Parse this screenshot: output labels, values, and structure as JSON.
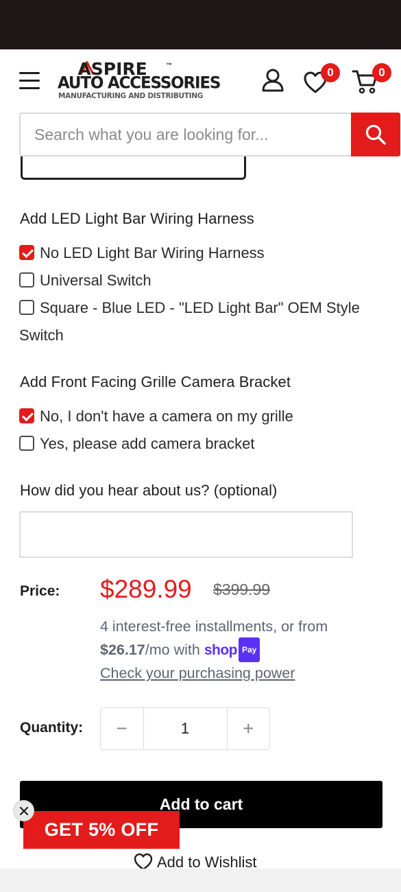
{
  "colors": {
    "accent": "#e31b1b",
    "statusbar": "#1e1718",
    "shoppay": "#5a31f4"
  },
  "header": {
    "logo": {
      "top": "ASPIRE",
      "tm": "™",
      "middle": "AUTO ACCESSORIES",
      "bottom": "MANUFACTURING AND DISTRIBUTING"
    },
    "wishlist_count": "0",
    "cart_count": "0"
  },
  "search": {
    "placeholder": "Search what you are looking for..."
  },
  "harness": {
    "title": "Add LED Light Bar Wiring Harness",
    "options": [
      {
        "label": "No LED Light Bar Wiring Harness",
        "checked": true
      },
      {
        "label": "Universal Switch",
        "checked": false
      },
      {
        "label": "Square - Blue LED - \"LED Light Bar\" OEM Style Switch",
        "checked": false
      }
    ]
  },
  "camera": {
    "title": "Add Front Facing Grille Camera Bracket",
    "options": [
      {
        "label": "No, I don't have a camera on my grille",
        "checked": true
      },
      {
        "label": "Yes, please add camera bracket",
        "checked": false
      }
    ]
  },
  "hear": {
    "title": "How did you hear about us? (optional)",
    "value": ""
  },
  "price": {
    "label": "Price:",
    "current": "$289.99",
    "original": "$399.99",
    "installments_text": "4 interest-free installments, or from",
    "monthly": "$26.17",
    "per_month": "/mo with",
    "shop_logo": "shop",
    "pay_badge": "Pay",
    "check_link": "Check your purchasing power"
  },
  "quantity": {
    "label": "Quantity:",
    "value": "1",
    "minus": "−",
    "plus": "+"
  },
  "actions": {
    "add_to_cart": "Add to cart",
    "wishlist": "Add to Wishlist"
  },
  "promo": {
    "label": "GET 5% OFF"
  }
}
